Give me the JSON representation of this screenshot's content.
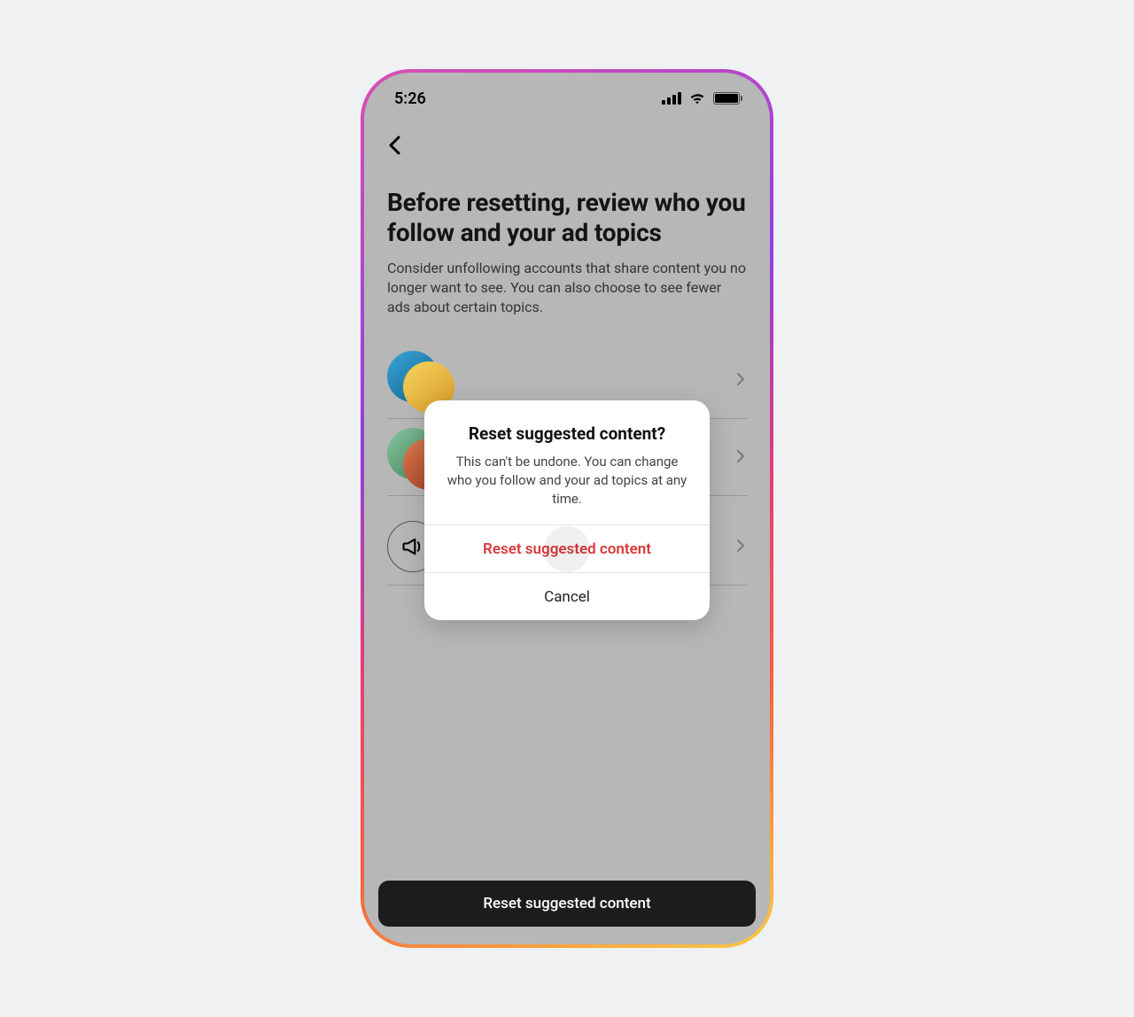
{
  "status": {
    "time": "5:26"
  },
  "page": {
    "title": "Before resetting, review who you follow and your ad topics",
    "subtitle": "Consider unfollowing accounts that share content you no longer want to see. You can also choose to see fewer ads about certain topics."
  },
  "rows": {
    "following": {
      "label": ""
    },
    "suggested": {
      "label": ""
    },
    "adtopics": {
      "label": ""
    }
  },
  "bottom": {
    "label": "Reset suggested content"
  },
  "dialog": {
    "title": "Reset suggested content?",
    "body": "This can't be undone. You can change who you follow and your ad topics at any time.",
    "confirm": "Reset suggested content",
    "cancel": "Cancel"
  }
}
